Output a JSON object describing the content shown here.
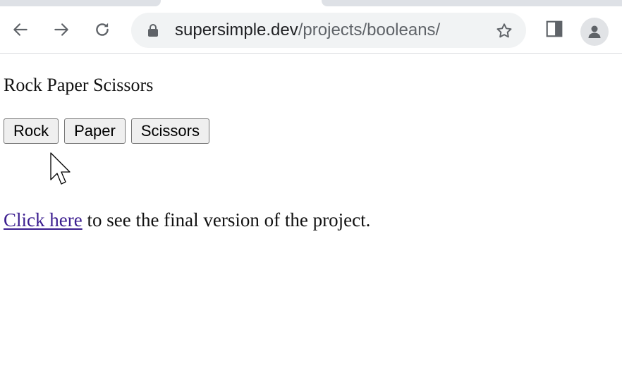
{
  "browser": {
    "icons": {
      "back": "back-arrow-icon",
      "forward": "forward-arrow-icon",
      "reload": "reload-icon",
      "lock": "lock-icon",
      "bookmark": "star-icon",
      "side_panel": "side-panel-icon",
      "profile": "profile-icon"
    },
    "url_host": "supersimple.dev",
    "url_path": "/projects/booleans/"
  },
  "page": {
    "title": "Rock Paper Scissors",
    "buttons": [
      "Rock",
      "Paper",
      "Scissors"
    ],
    "link_text": "Click here",
    "link_suffix": " to see the final version of the project."
  },
  "colors": {
    "link": "#3b1d8f",
    "omnibox": "#f1f3f4",
    "button_bg": "#efefef"
  }
}
